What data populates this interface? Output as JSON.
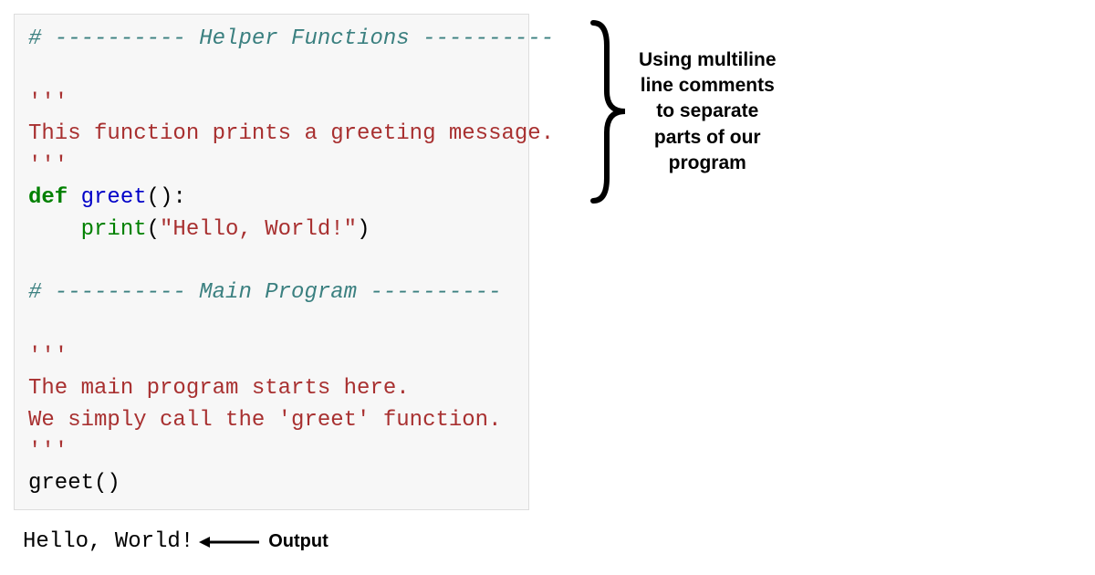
{
  "code": {
    "line1_a": "# ---------- ",
    "line1_b": "Helper Functions",
    "line1_c": " ----------",
    "blank": "",
    "tq1": "'''",
    "doc1": "This function prints a greeting message.",
    "tq2": "'''",
    "def_kw": "def",
    "def_sp": " ",
    "def_name": "greet",
    "def_paren": "():",
    "body_indent": "    ",
    "print_name": "print",
    "print_open": "(",
    "print_str": "\"Hello, World!\"",
    "print_close": ")",
    "line2_a": "# ---------- ",
    "line2_b": "Main Program",
    "line2_c": " ----------",
    "tq3": "'''",
    "doc2a": "The main program starts here.",
    "doc2b": "We simply call the 'greet' function.",
    "tq4": "'''",
    "call_name": "greet",
    "call_paren": "()"
  },
  "annotation": {
    "l1": "Using multiline",
    "l2": "line comments",
    "l3": "to separate",
    "l4": "parts of our",
    "l5": "program"
  },
  "output": {
    "text": "Hello, World!",
    "label": "Output"
  }
}
